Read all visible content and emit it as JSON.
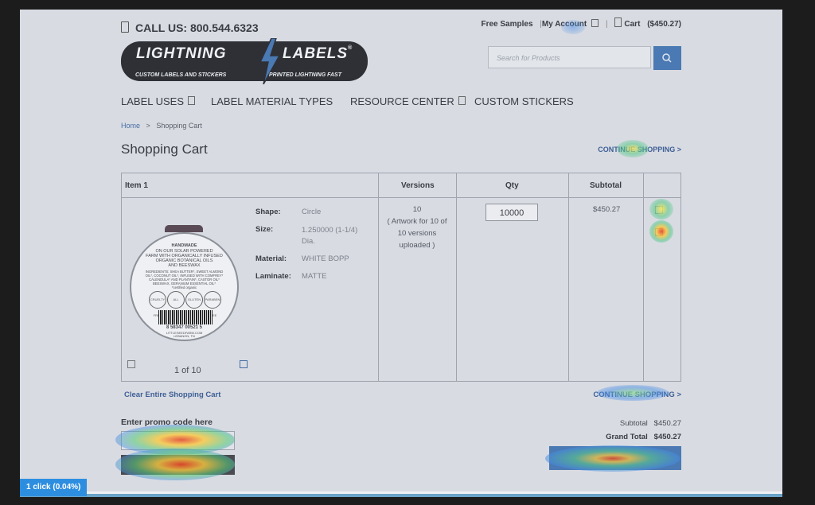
{
  "header": {
    "call_label": "CALL US: 800.544.6323",
    "free_samples": "Free Samples",
    "my_account": "My Account",
    "cart": "Cart",
    "cart_total": "($450.27)",
    "separator": "|"
  },
  "logo": {
    "word1": "LIGHTNING",
    "word2": "LABELS",
    "tag1": "CUSTOM LABELS AND STICKERS",
    "tag2": "PRINTED LIGHTNING FAST",
    "registered": "®"
  },
  "search": {
    "placeholder": "Search for Products"
  },
  "nav": [
    "LABEL USES",
    "LABEL MATERIAL TYPES",
    "RESOURCE CENTER",
    "CUSTOM STICKERS"
  ],
  "breadcrumb": {
    "home": "Home",
    "sep": ">",
    "current": "Shopping Cart"
  },
  "page_title": "Shopping Cart",
  "continue_shopping": "CONTINUE SHOPPING >",
  "table": {
    "headers": [
      "Item 1",
      "Versions",
      "Qty",
      "Subtotal"
    ],
    "item": {
      "shape_k": "Shape:",
      "shape_v": "Circle",
      "size_k": "Size:",
      "size_v": "1.250000 (1-1/4) Dia.",
      "material_k": "Material:",
      "material_v": "WHITE BOPP",
      "laminate_k": "Laminate:",
      "laminate_v": "MATTE",
      "versions": "10",
      "versions_note": "( Artwork for 10 of 10 versions uploaded )",
      "qty": "10000",
      "subtotal": "$450.27",
      "pager": "1 of 10"
    },
    "label_text": {
      "line1": "HANDMADE",
      "line2": "ON OUR SOLAR POWERED",
      "line3": "FARM WITH ORGANICALLY INFUSED",
      "line4": "ORGANIC BOTANICAL OILS",
      "line5": "AND BEESWAX",
      "ing1": "INGREDIENTS: SHEA BUTTER*, SWEET ALMOND",
      "ing2": "OIL*, COCONUT OIL*, INFUSED WITH COMFREY*",
      "ing3": "CALENDULA* AND PLANTAIN*, CASTOR OIL*",
      "ing4": "BEESWAX, GERANIUM ESSENTIAL OIL*",
      "ing5": "*certified organic",
      "badge1": "CRUELTY FREE",
      "badge2": "ALL NATURAL",
      "badge3": "GLUTEN FREE",
      "badge4": "PARABEN FREE",
      "barcode": "8 58347 00521 5",
      "site": "LITTLESEEDFARM.COM",
      "city": "LEBANON, TN"
    }
  },
  "clear_cart": "Clear Entire Shopping Cart",
  "promo": {
    "label": "Enter promo code here"
  },
  "totals": {
    "subtotal_label": "Subtotal",
    "subtotal": "$450.27",
    "grand_label": "Grand Total",
    "grand": "$450.27"
  },
  "heatmap": {
    "badge": "1 click (0.04%)"
  },
  "colors": {
    "accent": "#2d8ee0",
    "overlay": "#d8dbe2",
    "button_blue": "#4a79b3"
  }
}
